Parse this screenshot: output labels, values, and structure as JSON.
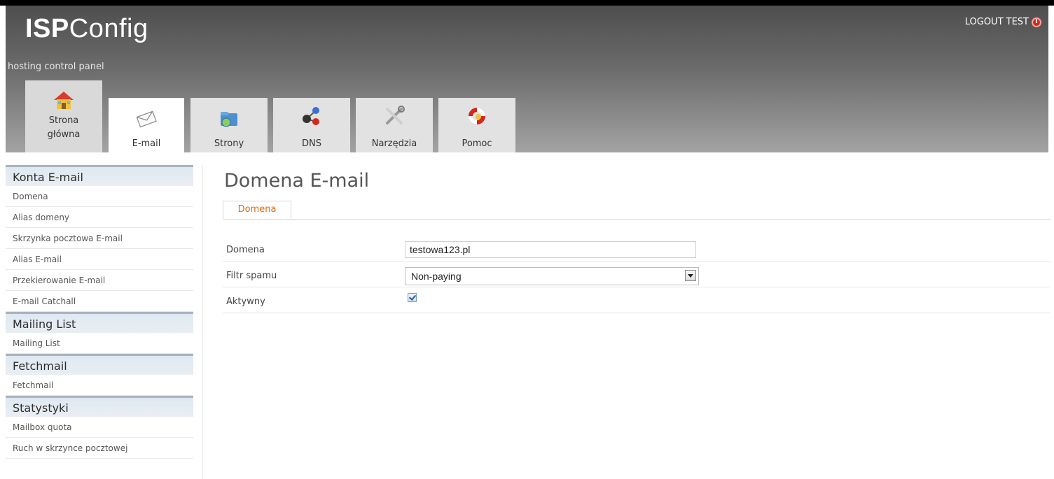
{
  "header": {
    "logo_bold": "ISP",
    "logo_regular": "Config",
    "tagline": "hosting control panel",
    "logout_label": "LOGOUT TEST"
  },
  "tabs": [
    {
      "label": "Strona główna",
      "icon": "home-icon"
    },
    {
      "label": "E-mail",
      "icon": "envelope-icon"
    },
    {
      "label": "Strony",
      "icon": "folder-globe-icon"
    },
    {
      "label": "DNS",
      "icon": "network-icon"
    },
    {
      "label": "Narzędzia",
      "icon": "tools-icon"
    },
    {
      "label": "Pomoc",
      "icon": "lifebuoy-icon"
    }
  ],
  "sidebar": {
    "sections": [
      {
        "title": "Konta E-mail",
        "items": [
          "Domena",
          "Alias domeny",
          "Skrzynka pocztowa E-mail",
          "Alias E-mail",
          "Przekierowanie E-mail",
          "E-mail Catchall"
        ]
      },
      {
        "title": "Mailing List",
        "items": [
          "Mailing List"
        ]
      },
      {
        "title": "Fetchmail",
        "items": [
          "Fetchmail"
        ]
      },
      {
        "title": "Statystyki",
        "items": [
          "Mailbox quota",
          "Ruch w skrzynce pocztowej"
        ]
      }
    ]
  },
  "main": {
    "title": "Domena E-mail",
    "subtab": "Domena",
    "form": {
      "domena_label": "Domena",
      "domena_value": "testowa123.pl",
      "spam_label": "Filtr spamu",
      "spam_value": "Non-paying",
      "aktywny_label": "Aktywny",
      "aktywny_checked": true
    }
  },
  "colors": {
    "accent_orange": "#e46a10",
    "logout_icon": "#d32b1f"
  }
}
